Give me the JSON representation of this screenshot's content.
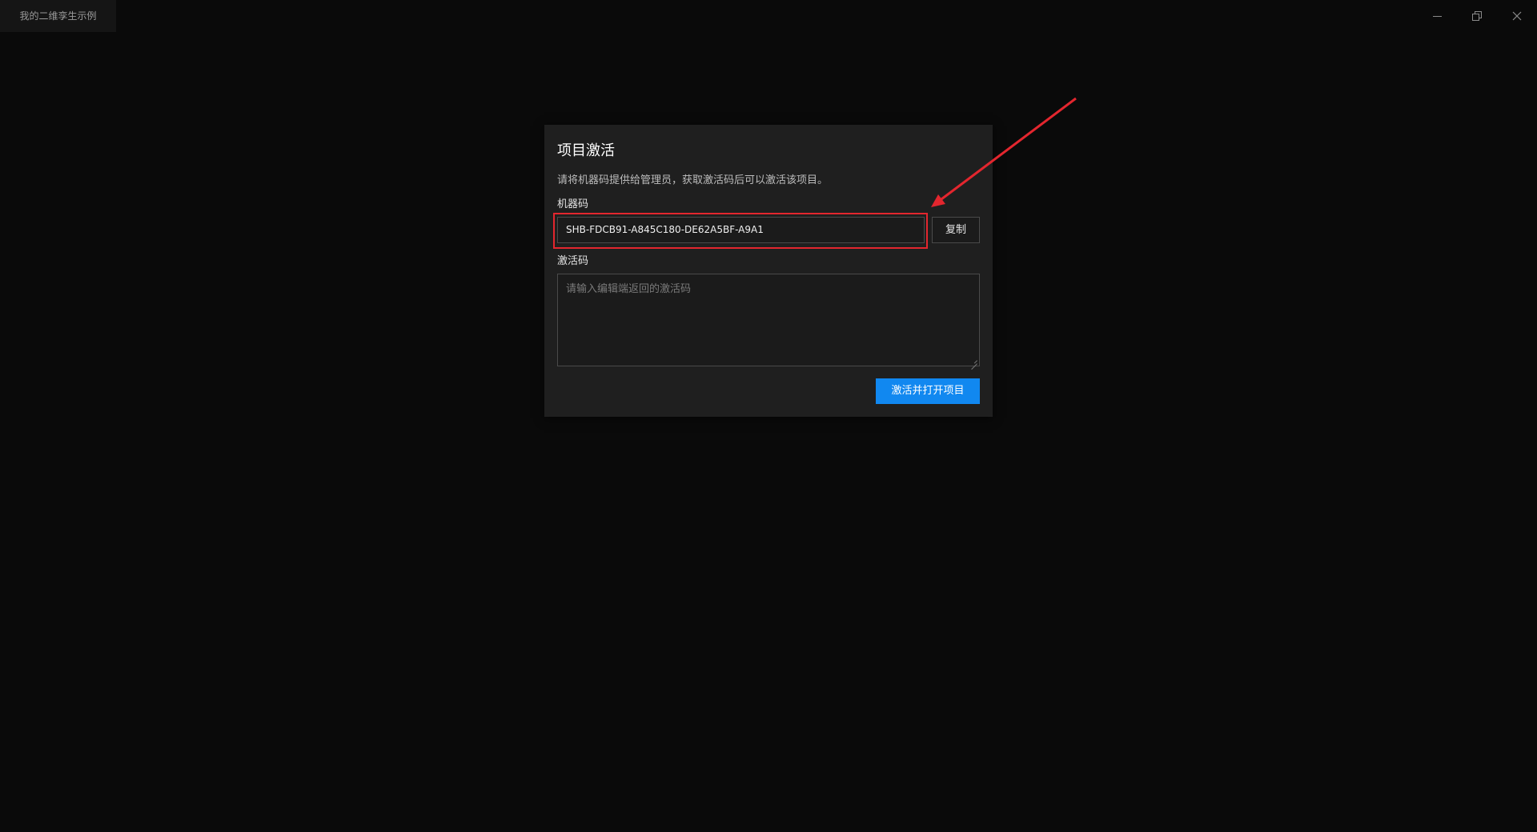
{
  "window": {
    "title": "我的二维孪生示例",
    "controls": {
      "minimize_icon": "minimize-icon",
      "maximize_icon": "restore-icon",
      "close_icon": "close-icon"
    }
  },
  "dialog": {
    "title": "项目激活",
    "description": "请将机器码提供给管理员，获取激活码后可以激活该项目。",
    "machine_code_label": "机器码",
    "machine_code_value": "SHB-FDCB91-A845C180-DE62A5BF-A9A1",
    "copy_button": "复制",
    "activation_code_label": "激活码",
    "activation_code_placeholder": "请输入编辑端返回的激活码",
    "activation_code_value": "",
    "submit_button": "激活并打开项目"
  },
  "colors": {
    "background": "#0a0a0a",
    "dialog_bg": "#1f1f1f",
    "primary": "#1188f0",
    "annotation": "#e3262e"
  }
}
